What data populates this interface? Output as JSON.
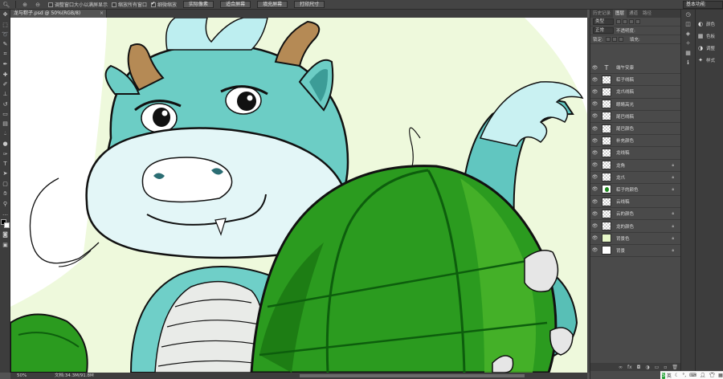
{
  "options_bar": {
    "checkbox_resize": "调整窗口大小以满屏显示",
    "checkbox_zoom_all": "缩放所有窗口",
    "checkbox_scrubby": "细微缩放",
    "btn_actual": "实际像素",
    "btn_fit": "适合屏幕",
    "btn_fill": "填充屏幕",
    "btn_print": "打印尺寸",
    "workspace": "基本功能"
  },
  "document": {
    "tab_title": "龙与粽子.psd @ 50%(RGB/8)",
    "zoom": "50%",
    "doc_size": "文档:34.3M/91.8M"
  },
  "layers_panel": {
    "tabs": [
      "历史记录",
      "图层",
      "通道",
      "路径"
    ],
    "active_tab": "图层",
    "filter_kind": "类型",
    "blend_mode": "正常",
    "opacity_label": "不透明度:",
    "lock_label": "锁定:",
    "fill_label": "填充:",
    "layers": [
      {
        "name": "端午安康",
        "thumb": "text",
        "locked": false
      },
      {
        "name": "粽子线稿",
        "thumb": "checker",
        "locked": false
      },
      {
        "name": "龙爪线稿",
        "thumb": "checker",
        "locked": false
      },
      {
        "name": "眼睛高光",
        "thumb": "checker",
        "locked": false
      },
      {
        "name": "尾巴线稿",
        "thumb": "checker",
        "locked": false
      },
      {
        "name": "尾巴颜色",
        "thumb": "checker",
        "locked": false
      },
      {
        "name": "补充颜色",
        "thumb": "checker",
        "locked": false
      },
      {
        "name": "龙线稿",
        "thumb": "checker",
        "locked": false
      },
      {
        "name": "龙角",
        "thumb": "checker",
        "locked": true
      },
      {
        "name": "龙爪",
        "thumb": "checker",
        "locked": true
      },
      {
        "name": "粽子的颜色",
        "thumb": "leaf",
        "locked": true
      },
      {
        "name": "云线稿",
        "thumb": "checker",
        "locked": false
      },
      {
        "name": "云的颜色",
        "thumb": "checker",
        "locked": true
      },
      {
        "name": "龙的颜色",
        "thumb": "checker",
        "locked": true
      },
      {
        "name": "背景色",
        "thumb": "green",
        "locked": true
      },
      {
        "name": "背景",
        "thumb": "white",
        "locked": true
      }
    ]
  },
  "dock": {
    "items": [
      "颜色",
      "色板",
      "调整",
      "样式"
    ]
  },
  "ime": {
    "logo": "S",
    "lang": "英"
  }
}
